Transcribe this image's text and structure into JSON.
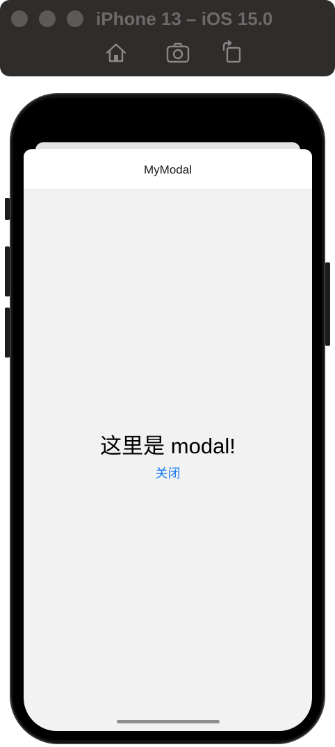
{
  "simulator": {
    "title": "iPhone 13 – iOS 15.0",
    "toolbar_icons": [
      "home-icon",
      "screenshot-icon",
      "rotate-icon"
    ]
  },
  "modal": {
    "header_title": "MyModal",
    "body_text": "这里是 modal!",
    "close_label": "关闭"
  },
  "colors": {
    "link": "#1a7cf5",
    "sheet_background": "#f2f2f2",
    "header_background": "#ffffff"
  }
}
